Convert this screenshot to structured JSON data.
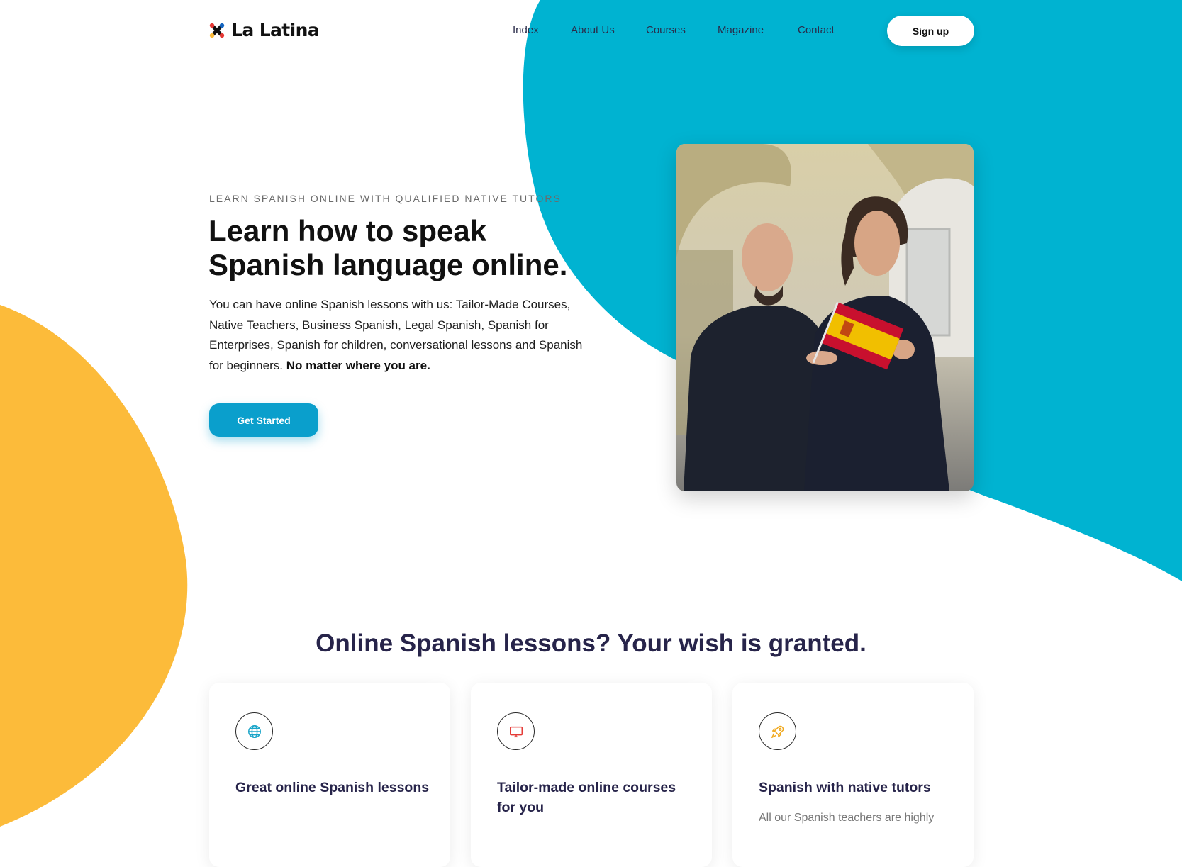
{
  "colors": {
    "brand_blue": "#00b3d1",
    "accent_yellow": "#fcbb3a",
    "cta_blue": "#0a9fcc",
    "heading_navy": "#27244a"
  },
  "header": {
    "brand": "La Latina",
    "nav": [
      "Index",
      "About Us",
      "Courses",
      "Magazine",
      "Contact"
    ],
    "signup_label": "Sign up"
  },
  "hero": {
    "eyebrow": "LEARN SPANISH ONLINE WITH QUALIFIED NATIVE TUTORS",
    "title": "Learn how to speak Spanish language online.",
    "description": "You can have online Spanish lessons with us: Tailor-Made Courses, Native Teachers, Business Spanish, Legal Spanish, Spanish for Enterprises, Spanish for children, conversational lessons and Spanish for beginners.",
    "description_emphasis": "No matter where you are.",
    "cta_label": "Get Started"
  },
  "features": {
    "title": "Online Spanish lessons? Your wish is granted.",
    "cards": [
      {
        "icon": "globe-icon",
        "title": "Great online Spanish lessons",
        "text": ""
      },
      {
        "icon": "monitor-icon",
        "title": "Tailor-made online courses for you",
        "text": ""
      },
      {
        "icon": "rocket-icon",
        "title": "Spanish with native tutors",
        "text": "All our Spanish teachers are highly"
      }
    ]
  }
}
